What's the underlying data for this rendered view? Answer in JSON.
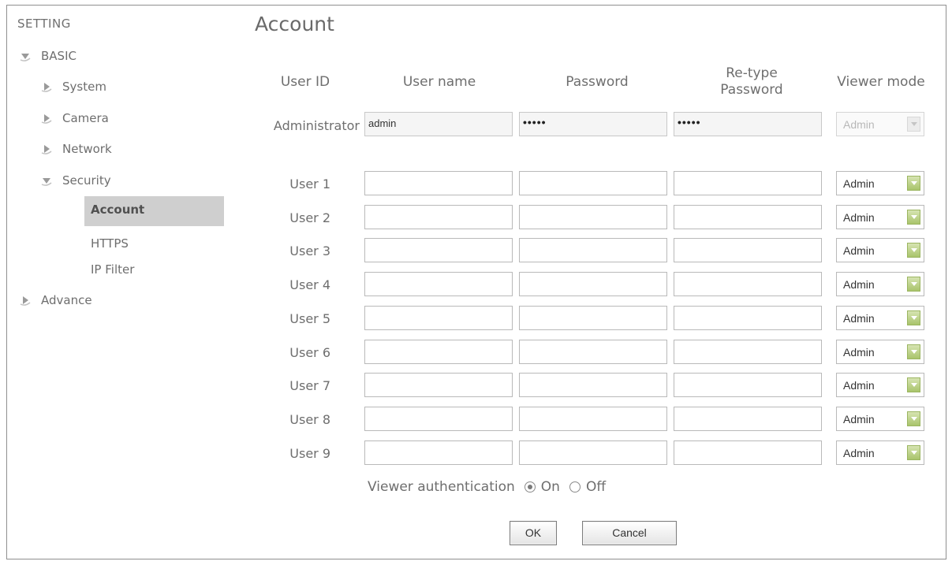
{
  "sidebar": {
    "title": "SETTING",
    "basic_label": "BASIC",
    "items": [
      {
        "label": "System"
      },
      {
        "label": "Camera"
      },
      {
        "label": "Network"
      },
      {
        "label": "Security"
      }
    ],
    "security_sub": [
      "Account",
      "HTTPS",
      "IP Filter"
    ],
    "advance_label": "Advance",
    "active_item": "Account"
  },
  "main": {
    "title": "Account",
    "columns": {
      "user_id": "User ID",
      "user_name": "User name",
      "password": "Password",
      "retype_line1": "Re-type",
      "retype_line2": "Password",
      "viewer_mode": "Viewer mode"
    },
    "admin": {
      "label": "Administrator",
      "user_name": "admin",
      "password": "•••••",
      "retype": "•••••",
      "viewer_mode": "Admin"
    },
    "users": [
      {
        "label": "User 1",
        "viewer_mode": "Admin"
      },
      {
        "label": "User 2",
        "viewer_mode": "Admin"
      },
      {
        "label": "User 3",
        "viewer_mode": "Admin"
      },
      {
        "label": "User 4",
        "viewer_mode": "Admin"
      },
      {
        "label": "User 5",
        "viewer_mode": "Admin"
      },
      {
        "label": "User 6",
        "viewer_mode": "Admin"
      },
      {
        "label": "User 7",
        "viewer_mode": "Admin"
      },
      {
        "label": "User 8",
        "viewer_mode": "Admin"
      },
      {
        "label": "User 9",
        "viewer_mode": "Admin"
      }
    ],
    "viewer_auth": {
      "label": "Viewer authentication",
      "on_label": "On",
      "off_label": "Off",
      "selected": "On"
    },
    "buttons": {
      "ok": "OK",
      "cancel": "Cancel"
    }
  },
  "colors": {
    "active_bg": "#cfcfcf",
    "select_button": "#a9c46b",
    "text": "#6e6e6e"
  }
}
